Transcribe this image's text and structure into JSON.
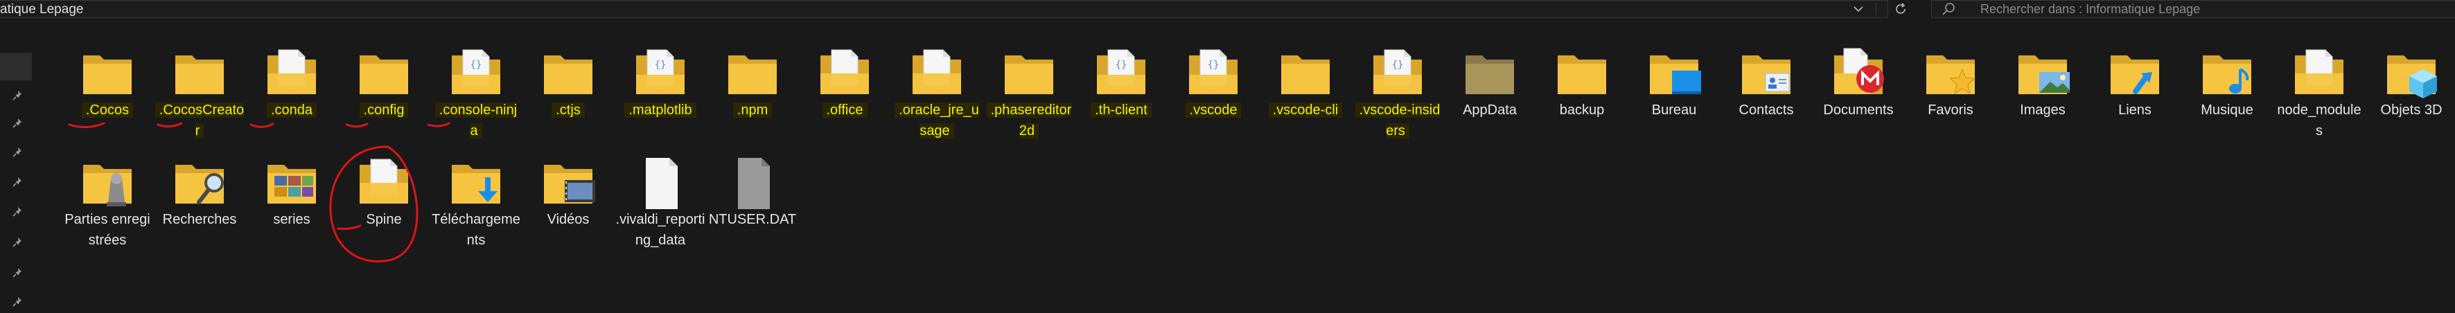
{
  "address": {
    "text": "atique Lepage"
  },
  "search": {
    "placeholder": "Rechercher dans : Informatique Lepage"
  },
  "colors": {
    "folder": "#f5c542",
    "folder_dark": "#d9a62b",
    "highlight_text": "#f4f100",
    "annotation": "#e0131a"
  },
  "items": [
    {
      "label": ".Cocos",
      "icon": "folder-icon",
      "highlight": true
    },
    {
      "label": ".CocosCreator",
      "icon": "folder-icon",
      "highlight": true
    },
    {
      "label": ".conda",
      "icon": "folder-doc-icon",
      "highlight": true
    },
    {
      "label": ".config",
      "icon": "folder-icon",
      "highlight": true
    },
    {
      "label": ".console-ninja",
      "icon": "folder-code-icon",
      "highlight": true
    },
    {
      "label": ".ctjs",
      "icon": "folder-icon",
      "highlight": true
    },
    {
      "label": ".matplotlib",
      "icon": "folder-code-icon",
      "highlight": true
    },
    {
      "label": ".npm",
      "icon": "folder-icon",
      "highlight": true
    },
    {
      "label": ".office",
      "icon": "folder-doc-icon",
      "highlight": true
    },
    {
      "label": ".oracle_jre_usage",
      "icon": "folder-doc-icon",
      "highlight": true
    },
    {
      "label": ".phasereditor2d",
      "icon": "folder-icon",
      "highlight": true
    },
    {
      "label": ".th-client",
      "icon": "folder-code-icon",
      "highlight": true
    },
    {
      "label": ".vscode",
      "icon": "folder-code-icon",
      "highlight": true
    },
    {
      "label": ".vscode-cli",
      "icon": "folder-icon",
      "highlight": true
    },
    {
      "label": ".vscode-insiders",
      "icon": "folder-code-icon",
      "highlight": true
    },
    {
      "label": "AppData",
      "icon": "folder-dim-icon",
      "highlight": false
    },
    {
      "label": "backup",
      "icon": "folder-icon",
      "highlight": false
    },
    {
      "label": "Bureau",
      "icon": "desktop-folder-icon",
      "highlight": false
    },
    {
      "label": "Contacts",
      "icon": "contacts-folder-icon",
      "highlight": false
    },
    {
      "label": "Documents",
      "icon": "mega-folder-icon",
      "highlight": false
    },
    {
      "label": "Favoris",
      "icon": "favorites-folder-icon",
      "highlight": false
    },
    {
      "label": "Images",
      "icon": "pictures-folder-icon",
      "highlight": false
    },
    {
      "label": "Liens",
      "icon": "links-folder-icon",
      "highlight": false
    },
    {
      "label": "Musique",
      "icon": "music-folder-icon",
      "highlight": false
    },
    {
      "label": "node_modules",
      "icon": "folder-doc-icon",
      "highlight": false
    },
    {
      "label": "Objets 3D",
      "icon": "3d-objects-folder-icon",
      "highlight": false
    },
    {
      "label": "Parties enregistrées",
      "icon": "saved-games-folder-icon",
      "highlight": false
    },
    {
      "label": "Recherches",
      "icon": "searches-folder-icon",
      "highlight": false
    },
    {
      "label": "series",
      "icon": "series-folder-icon",
      "highlight": false
    },
    {
      "label": "Spine",
      "icon": "folder-doc-icon",
      "highlight": false
    },
    {
      "label": "Téléchargements",
      "icon": "downloads-folder-icon",
      "highlight": false
    },
    {
      "label": "Vidéos",
      "icon": "videos-folder-icon",
      "highlight": false
    },
    {
      "label": ".vivaldi_reporting_data",
      "icon": "file-icon",
      "highlight": false
    },
    {
      "label": "NTUSER.DAT",
      "icon": "system-file-icon",
      "highlight": false
    }
  ]
}
